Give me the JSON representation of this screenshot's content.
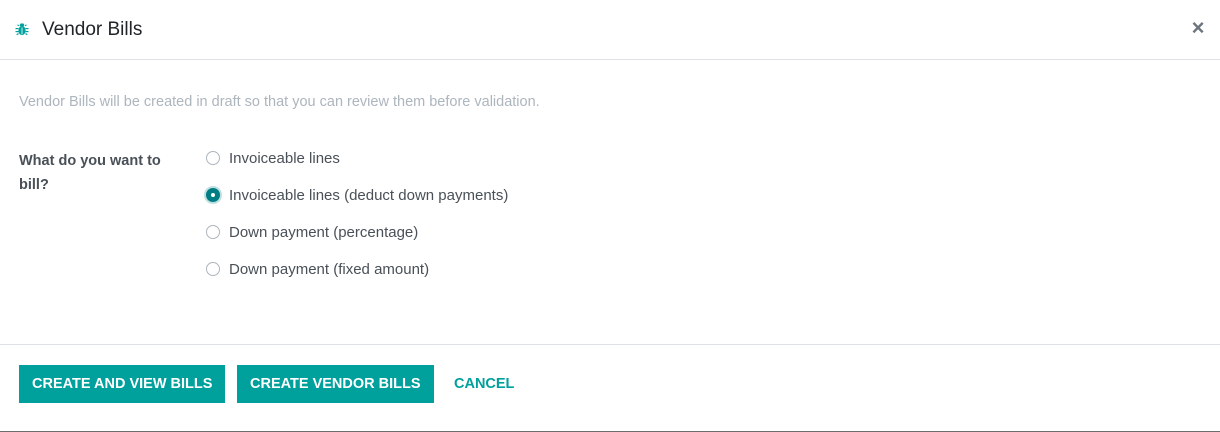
{
  "dialog": {
    "title": "Vendor Bills",
    "title_icon": "bug-icon",
    "close_icon": "close-icon",
    "close_glyph": "×"
  },
  "form": {
    "info_text": "Vendor Bills will be created in draft so that you can review them before validation.",
    "field_label": "What do you want to bill?",
    "options": [
      {
        "label": "Invoiceable lines",
        "checked": false
      },
      {
        "label": "Invoiceable lines (deduct down payments)",
        "checked": true
      },
      {
        "label": "Down payment (percentage)",
        "checked": false
      },
      {
        "label": "Down payment (fixed amount)",
        "checked": false
      }
    ]
  },
  "footer": {
    "create_view_label": "CREATE AND VIEW BILLS",
    "create_label": "CREATE VENDOR BILLS",
    "cancel_label": "CANCEL"
  },
  "colors": {
    "accent": "#00a09d",
    "radio_checked": "#017e84",
    "muted_text": "#adb5bd"
  }
}
